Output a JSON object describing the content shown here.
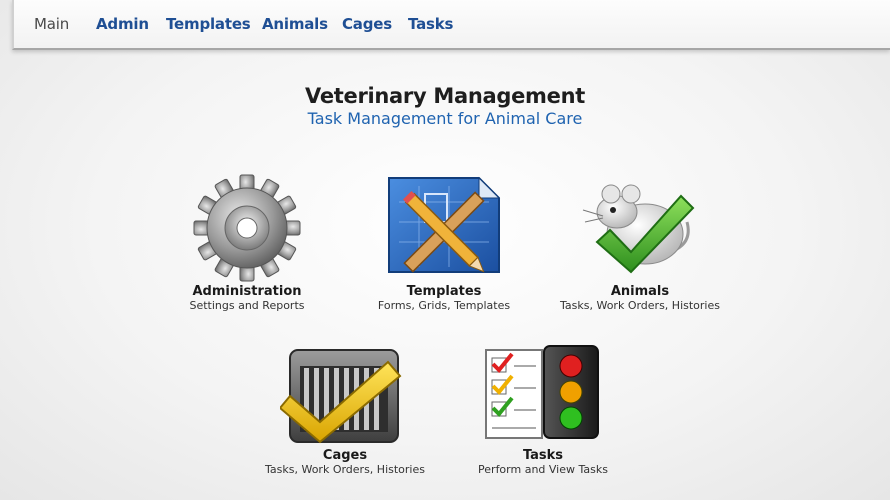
{
  "nav": {
    "items": [
      {
        "label": "Main",
        "active": true
      },
      {
        "label": "Admin"
      },
      {
        "label": "Templates"
      },
      {
        "label": "Animals"
      },
      {
        "label": "Cages"
      },
      {
        "label": "Tasks"
      }
    ]
  },
  "header": {
    "title": "Veterinary Management",
    "subtitle": "Task Management for Animal Care"
  },
  "tiles": [
    {
      "label": "Administration",
      "desc": "Settings and Reports",
      "icon": "gear-icon"
    },
    {
      "label": "Templates",
      "desc": "Forms, Grids, Templates",
      "icon": "blueprint-pencil-ruler-icon"
    },
    {
      "label": "Animals",
      "desc": "Tasks, Work Orders, Histories",
      "icon": "mouse-checkmark-icon"
    },
    {
      "label": "Cages",
      "desc": "Tasks, Work Orders, Histories",
      "icon": "cage-checkmark-icon"
    },
    {
      "label": "Tasks",
      "desc": "Perform and View Tasks",
      "icon": "checklist-traffic-light-icon"
    }
  ],
  "colors": {
    "nav_link": "#1f4f94",
    "subtitle": "#1f63b0",
    "check_green": "#3aa52a",
    "check_yellow": "#f2c200"
  }
}
